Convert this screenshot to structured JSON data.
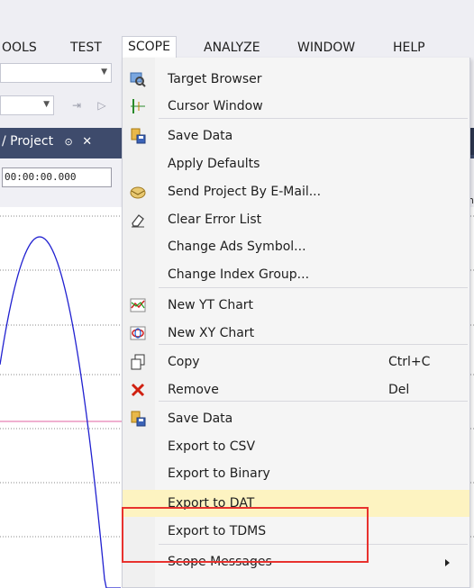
{
  "menubar": {
    "items": [
      "OOLS",
      "TEST",
      "SCOPE",
      "ANALYZE",
      "WINDOW",
      "HELP"
    ],
    "active": "SCOPE"
  },
  "doc_tab": {
    "title": "/ Project",
    "pin": "⌐",
    "close": "✕"
  },
  "chart": {
    "time_value": "00:00:00.000",
    "right_hint": "In"
  },
  "scope_menu": {
    "items": [
      {
        "label": "Target Browser",
        "icon": "target-browser-icon"
      },
      {
        "label": "Cursor Window",
        "icon": "cursor-window-icon"
      },
      {
        "label": "Save Data",
        "icon": "save-data-icon"
      },
      {
        "label": "Apply Defaults",
        "icon": ""
      },
      {
        "label": "Send Project By E-Mail...",
        "icon": "email-icon"
      },
      {
        "label": "Clear Error List",
        "icon": "eraser-icon"
      },
      {
        "label": "Change Ads Symbol...",
        "icon": ""
      },
      {
        "label": "Change Index Group...",
        "icon": ""
      },
      {
        "label": "New YT Chart",
        "icon": "yt-chart-icon"
      },
      {
        "label": "New XY Chart",
        "icon": "xy-chart-icon"
      },
      {
        "label": "Copy",
        "icon": "copy-icon",
        "shortcut": "Ctrl+C"
      },
      {
        "label": "Remove",
        "icon": "remove-icon",
        "shortcut": "Del"
      },
      {
        "label": "Save Data",
        "icon": "save-data-icon"
      },
      {
        "label": "Export to CSV",
        "icon": ""
      },
      {
        "label": "Export to Binary",
        "icon": ""
      },
      {
        "label": "Export to DAT",
        "icon": "",
        "highlighted": true
      },
      {
        "label": "Export to TDMS",
        "icon": ""
      },
      {
        "label": "Scope Messages",
        "icon": "",
        "submenu": true
      }
    ]
  },
  "colors": {
    "highlight": "#fdf3c1",
    "annotation_box": "#e8322e",
    "tab_bg": "#3e4b6c",
    "curve": "#2020d0",
    "marker_line": "#e060a0"
  }
}
